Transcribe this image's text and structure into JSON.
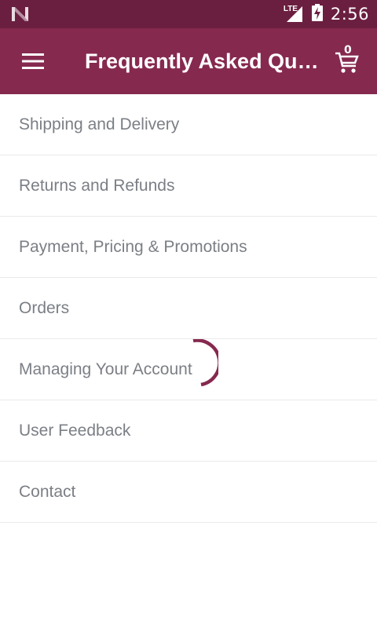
{
  "status_bar": {
    "network_label": "LTE",
    "time": "2:56"
  },
  "app_bar": {
    "title": "Frequently Asked Questions",
    "cart_count": "0"
  },
  "faq_items": [
    {
      "label": "Shipping and Delivery"
    },
    {
      "label": "Returns and Refunds"
    },
    {
      "label": "Payment, Pricing & Promotions"
    },
    {
      "label": "Orders"
    },
    {
      "label": "Managing Your Account"
    },
    {
      "label": "User Feedback"
    },
    {
      "label": "Contact"
    }
  ],
  "colors": {
    "status_bar": "#6b1f40",
    "app_bar": "#86294f",
    "spinner": "#86294f",
    "item_text": "#7b7f85"
  },
  "icons": {
    "status_left": "n-logo-icon",
    "signal": "lte-signal-icon",
    "battery": "battery-charging-icon",
    "menu": "hamburger-menu-icon",
    "cart": "shopping-cart-icon"
  }
}
